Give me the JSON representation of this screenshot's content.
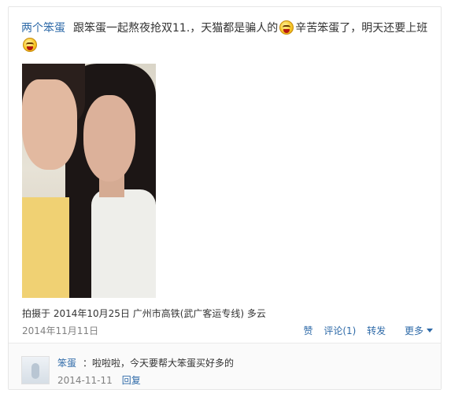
{
  "post": {
    "author": "两个笨蛋",
    "text_part1": "跟笨蛋一起熬夜抢双11.，天猫都是骗人的",
    "text_part2": "辛苦笨蛋了，明天还要上班",
    "emoji_name": "shocked-face-emoji",
    "location_line": "拍摄于 2014年10月25日 广州市高铁(武广客运专线) 多云",
    "date": "2014年11月11日"
  },
  "actions": {
    "like": "赞",
    "comment": "评论(1)",
    "repost": "转发",
    "more": "更多"
  },
  "comment": {
    "user": "笨蛋",
    "text": "：啦啦啦，今天要帮大笨蛋买好多的",
    "date": "2014-11-11",
    "reply": "回复"
  },
  "colors": {
    "link": "#2e6aa8",
    "meta": "#808080",
    "text": "#333333"
  }
}
